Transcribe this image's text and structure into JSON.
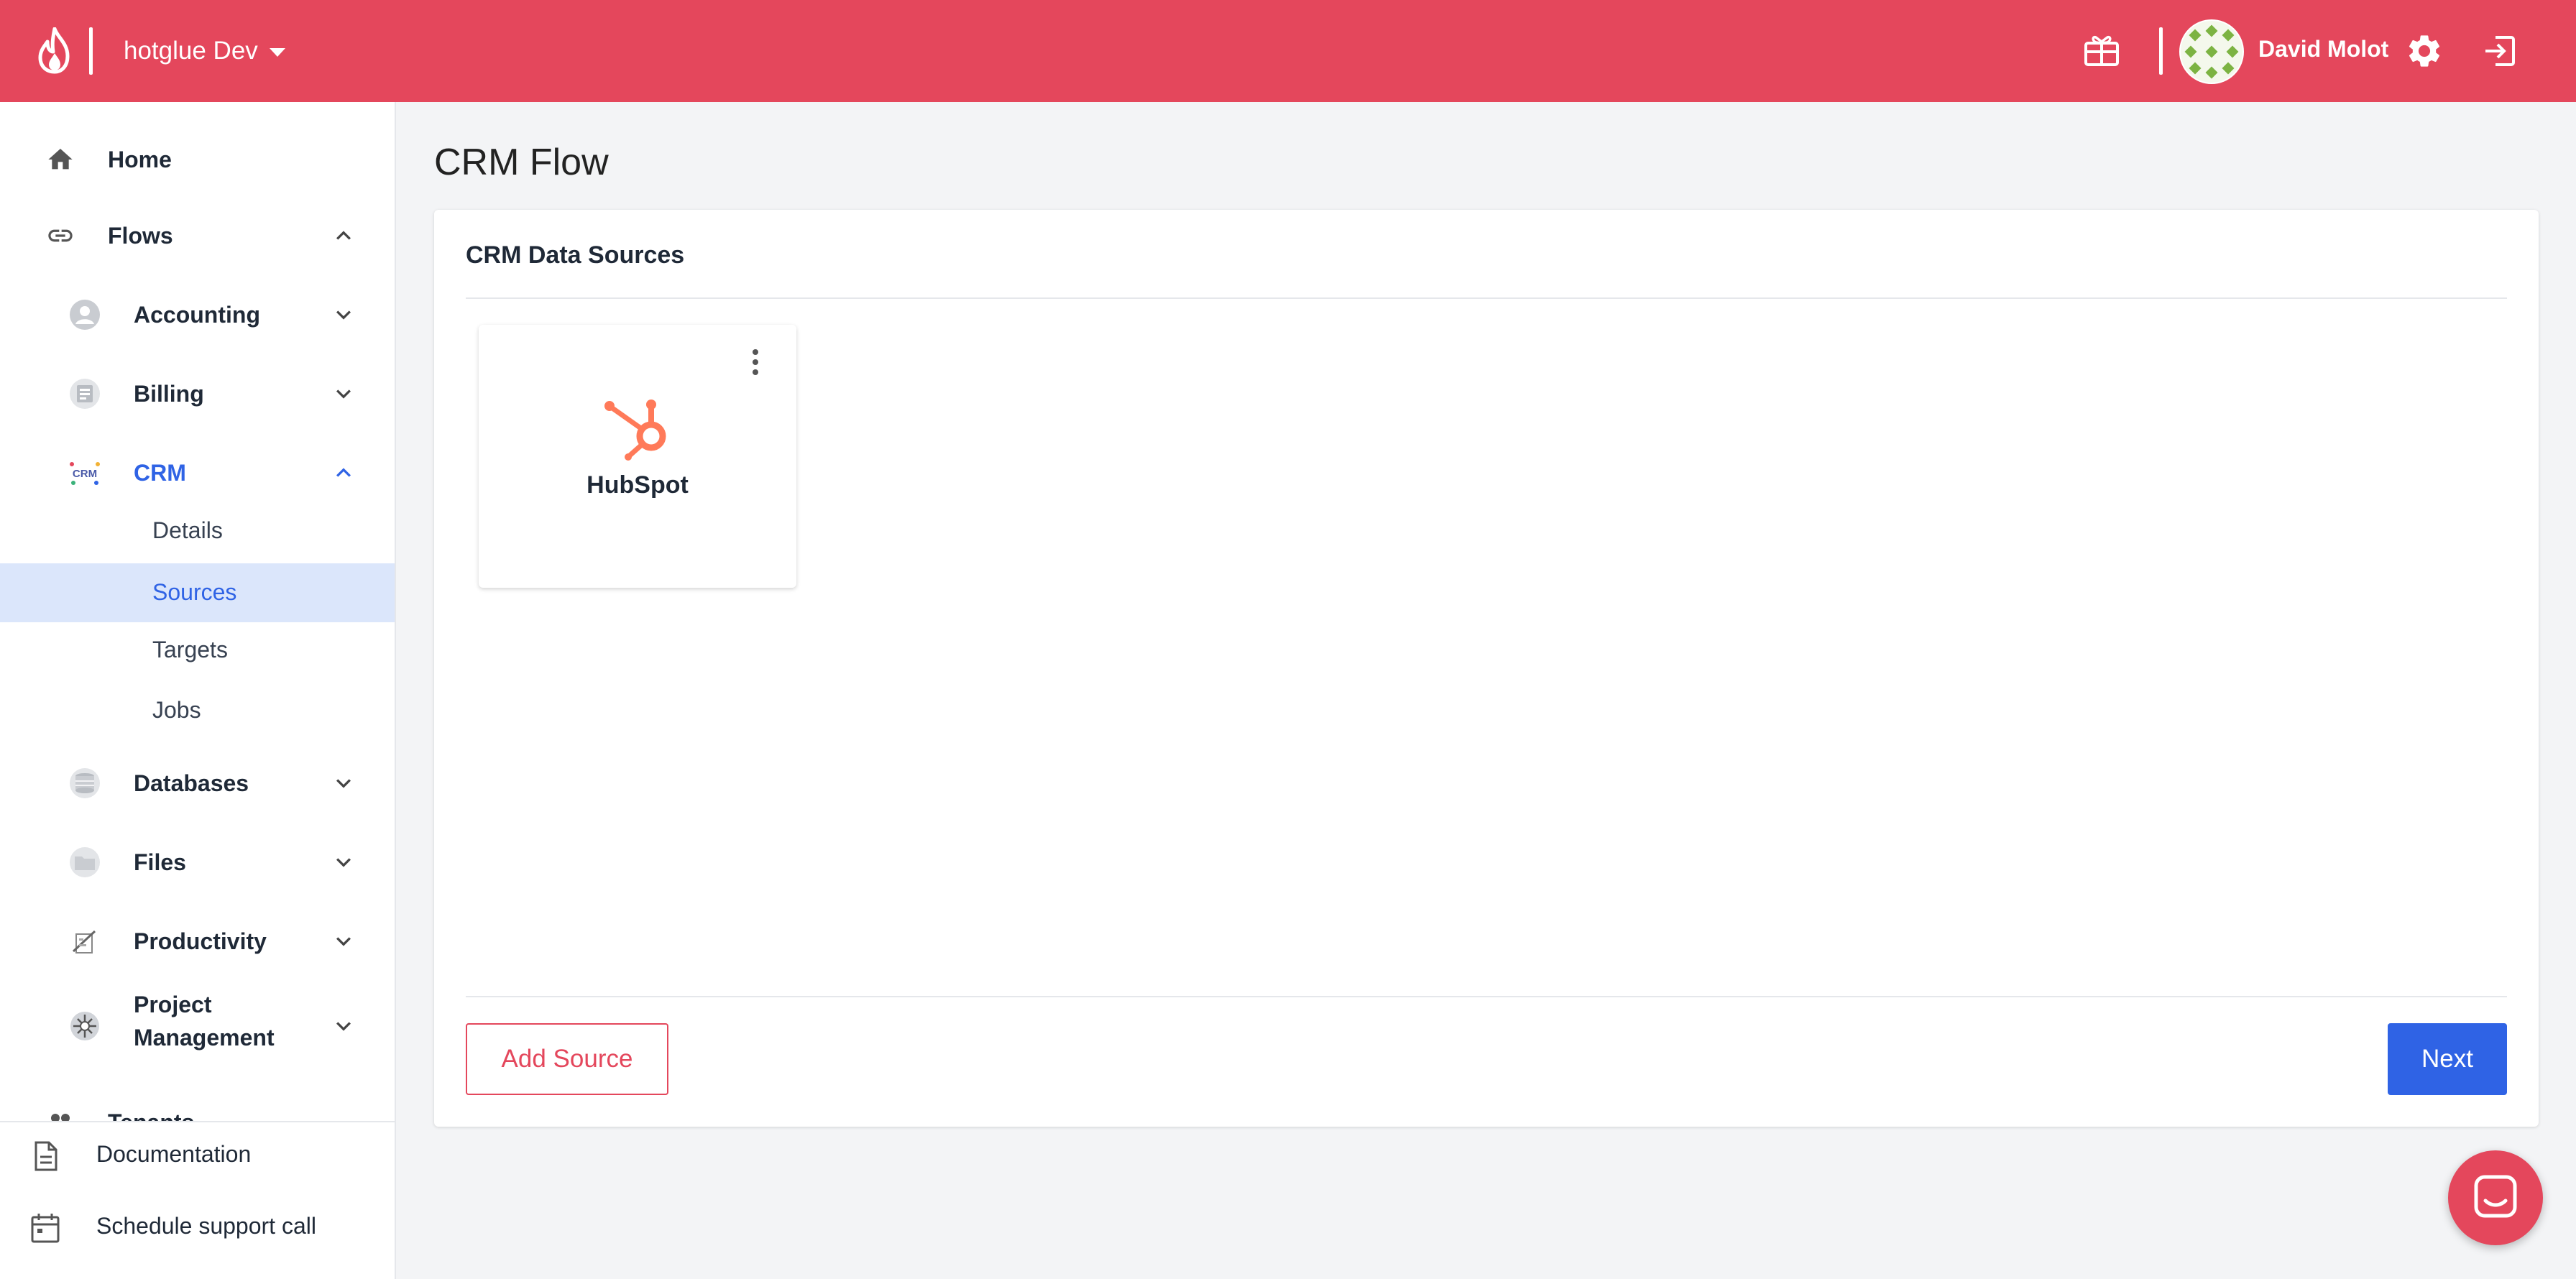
{
  "topbar": {
    "env_name": "hotglue Dev",
    "user_name": "David Molot",
    "brand_color": "#e4475c"
  },
  "sidebar": {
    "home": "Home",
    "flows": "Flows",
    "categories": {
      "accounting": "Accounting",
      "billing": "Billing",
      "crm": "CRM",
      "databases": "Databases",
      "files": "Files",
      "productivity": "Productivity",
      "project_management_line1": "Project",
      "project_management_line2": "Management"
    },
    "crm_icon_text": "CRM",
    "crm_subitems": {
      "details": "Details",
      "sources": "Sources",
      "targets": "Targets",
      "jobs": "Jobs"
    },
    "tenants": "Tenants",
    "documentation": "Documentation",
    "schedule_call": "Schedule support call",
    "active_color": "#2f63e5"
  },
  "main": {
    "page_title": "CRM Flow",
    "card_title": "CRM Data Sources",
    "sources": [
      {
        "name": "HubSpot"
      }
    ],
    "add_source_label": "Add Source",
    "next_label": "Next"
  }
}
